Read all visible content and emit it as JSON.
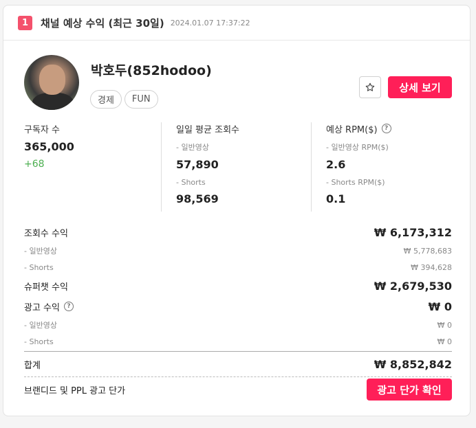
{
  "header": {
    "rank": "1",
    "title": "채널 예상 수익 (최근 30일)",
    "timestamp": "2024.01.07 17:37:22"
  },
  "channel": {
    "name": "박호두(852hodoo)",
    "tags": [
      "경제",
      "FUN"
    ],
    "star_icon": "star-outline-icon",
    "detail_button": "상세 보기"
  },
  "stats": {
    "subscribers": {
      "label": "구독자 수",
      "value": "365,000",
      "change": "+68"
    },
    "daily_views": {
      "label": "일일 평균 조회수",
      "general_label": "- 일반영상",
      "general_value": "57,890",
      "shorts_label": "- Shorts",
      "shorts_value": "98,569"
    },
    "rpm": {
      "label": "예상 RPM($)",
      "help": "?",
      "general_label": "- 일반영상 RPM($)",
      "general_value": "2.6",
      "shorts_label": "- Shorts RPM($)",
      "shorts_value": "0.1"
    }
  },
  "revenue": {
    "view_revenue": {
      "label": "조회수 수익",
      "value": "₩ 6,173,312"
    },
    "view_general": {
      "label": "- 일반영상",
      "value": "₩ 5,778,683"
    },
    "view_shorts": {
      "label": "- Shorts",
      "value": "₩ 394,628"
    },
    "superchat": {
      "label": "슈퍼챗 수익",
      "value": "₩ 2,679,530"
    },
    "ad_revenue": {
      "label": "광고 수익",
      "help": "?",
      "value": "₩ 0"
    },
    "ad_general": {
      "label": "- 일반영상",
      "value": "₩ 0"
    },
    "ad_shorts": {
      "label": "- Shorts",
      "value": "₩ 0"
    },
    "total": {
      "label": "합계",
      "value": "₩ 8,852,842"
    }
  },
  "brand": {
    "label": "브랜디드 및 PPL 광고 단가",
    "button": "광고 단가 확인"
  },
  "colors": {
    "accent": "#ff1f58",
    "rank_badge": "#f4516c",
    "positive": "#4caf50"
  }
}
